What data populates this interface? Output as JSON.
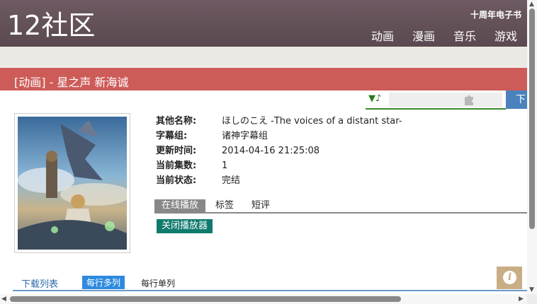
{
  "header": {
    "logo": "12社区",
    "ebook_link": "十周年电子书",
    "nav": [
      "动画",
      "漫画",
      "音乐",
      "游戏"
    ]
  },
  "title_bar": {
    "title": "[动画] - 星之声 新海诚"
  },
  "music_widget": {
    "control": "▼♪",
    "icon": "puzzle-icon"
  },
  "download_button": "下",
  "info": [
    {
      "label": "其他名称:",
      "value": "ほしのこえ -The voices of a distant star-"
    },
    {
      "label": "字幕组:",
      "value": "诸神字幕组"
    },
    {
      "label": "更新时间:",
      "value": "2014-04-16 21:25:08"
    },
    {
      "label": "当前集数:",
      "value": "1"
    },
    {
      "label": "当前状态:",
      "value": "完结"
    }
  ],
  "tabs": [
    "在线播放",
    "标签",
    "短评"
  ],
  "close_player": "关闭播放器",
  "download_list": {
    "title": "下载列表",
    "option_multi": "每行多列",
    "option_single": "每行单列"
  },
  "info_button": "i",
  "colors": {
    "header": "#6e5a62",
    "title_bar": "#cd5b58",
    "accent_green": "#0f7a6e",
    "accent_blue": "#2d8ae0"
  }
}
